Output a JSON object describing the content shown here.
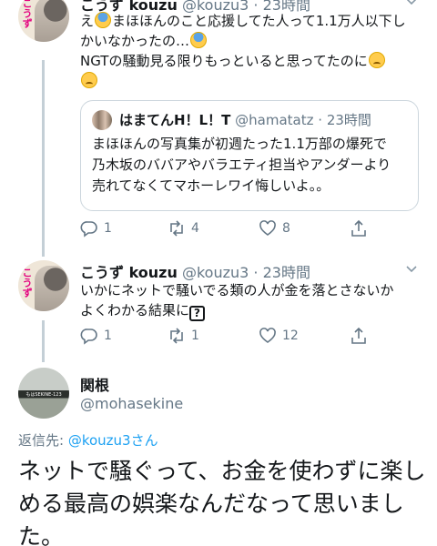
{
  "tweet1": {
    "name": "こうず kouzu",
    "handle": "@kouzu3",
    "dot": "·",
    "time": "23時間",
    "line1": "え",
    "line1b": "まほほんのこと応援してた人って1.1万人以下し",
    "line2": "かいなかったの…",
    "line3": "NGTの騒動見る限りもっといると思ってたのに",
    "avatar_text": "こうず",
    "quote": {
      "name": "はまてんH！L！T",
      "handle": "@hamatatz",
      "dot": "·",
      "time": "23時間",
      "line1": "まほほんの写真集が初週たった1.1万部の爆死で",
      "line2": "乃木坂のババアやバラエティ担当やアンダーより",
      "line3": "売れてなくてマホーレワイ悔しいよ。。"
    },
    "actions": {
      "reply": "1",
      "retweet": "4",
      "like": "8"
    }
  },
  "tweet2": {
    "name": "こうず kouzu",
    "handle": "@kouzu3",
    "dot": "·",
    "time": "23時間",
    "line1": "いかにネットで騒いでる類の人が金を落とさないか",
    "line2": "よくわかる結果に",
    "qbox": "?",
    "avatar_text": "こうず",
    "actions": {
      "reply": "1",
      "retweet": "1",
      "like": "12"
    }
  },
  "tweet3": {
    "name": "関根",
    "handle": "@mohasekine",
    "sign_text": "もはSEKINE-123",
    "reply_label": "返信先:",
    "reply_to": "@kouzu3さん",
    "text": "ネットで騒ぐって、お金を使わずに楽しめる最高の娯楽なんだなって思いました。"
  },
  "colors": {
    "accent": "#1da1f2",
    "muted": "#657786",
    "border": "#ccd6dd",
    "thread": "#c4cfd6"
  }
}
